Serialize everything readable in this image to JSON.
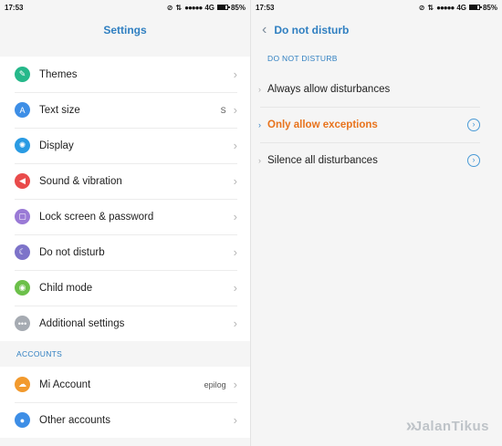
{
  "left": {
    "status": {
      "time": "17:53",
      "signal": "●●●●●",
      "network": "4G",
      "battery": "85%",
      "battery_level": 0.85
    },
    "title": "Settings",
    "items": [
      {
        "label": "Themes",
        "icon": "themes-icon",
        "glyph": "✎",
        "color": "#26b88a",
        "value": ""
      },
      {
        "label": "Text size",
        "icon": "text-size-icon",
        "glyph": "A",
        "color": "#3d8ee6",
        "value": "S"
      },
      {
        "label": "Display",
        "icon": "display-icon",
        "glyph": "✺",
        "color": "#2a9be3",
        "value": ""
      },
      {
        "label": "Sound & vibration",
        "icon": "sound-icon",
        "glyph": "◀",
        "color": "#e94b4b",
        "value": ""
      },
      {
        "label": "Lock screen & password",
        "icon": "lock-icon",
        "glyph": "▢",
        "color": "#9a7ad6",
        "value": ""
      },
      {
        "label": "Do not disturb",
        "icon": "moon-icon",
        "glyph": "☾",
        "color": "#7d73c9",
        "value": ""
      },
      {
        "label": "Child mode",
        "icon": "child-mode-icon",
        "glyph": "◉",
        "color": "#6cc04a",
        "value": ""
      },
      {
        "label": "Additional settings",
        "icon": "more-icon",
        "glyph": "•••",
        "color": "#a6abb2",
        "value": ""
      }
    ],
    "accounts_header": "ACCOUNTS",
    "accounts": [
      {
        "label": "Mi Account",
        "icon": "cloud-icon",
        "glyph": "☁",
        "color": "#f29a2e",
        "value": "epilog"
      },
      {
        "label": "Other accounts",
        "icon": "user-icon",
        "glyph": "●",
        "color": "#3d8ee6",
        "value": ""
      }
    ]
  },
  "right": {
    "status": {
      "time": "17:53",
      "signal": "●●●●●",
      "network": "4G",
      "battery": "85%",
      "battery_level": 0.85
    },
    "title": "Do not disturb",
    "section_header": "DO NOT DISTURB",
    "options": [
      {
        "label": "Always allow disturbances",
        "selected": false,
        "has_info": false
      },
      {
        "label": "Only allow exceptions",
        "selected": true,
        "has_info": true
      },
      {
        "label": "Silence all disturbances",
        "selected": false,
        "has_info": true
      }
    ]
  },
  "watermark": {
    "text": "JalanTikus"
  },
  "colors": {
    "accent": "#2f7fc1",
    "selected": "#e8731c"
  }
}
